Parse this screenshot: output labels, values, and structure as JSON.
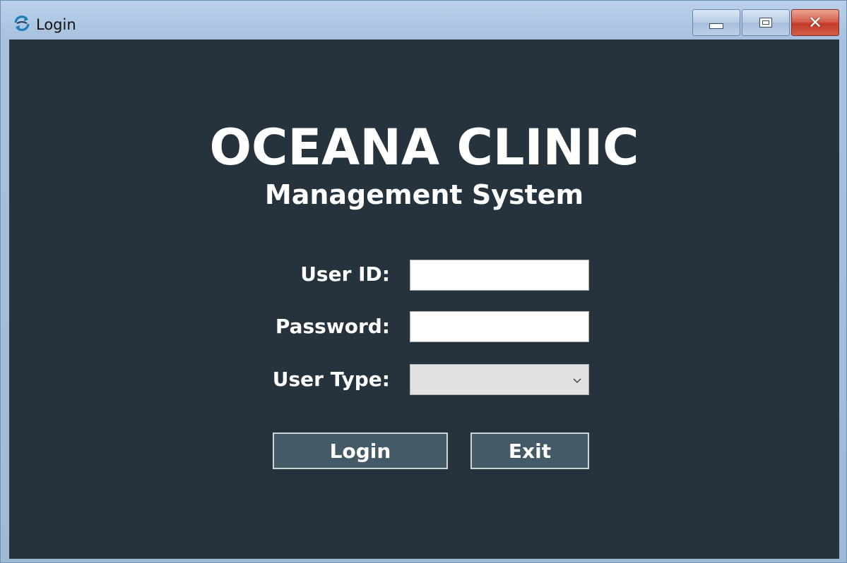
{
  "window": {
    "title": "Login",
    "app_icon": "refresh-icon",
    "controls": {
      "minimize": "minimize-icon",
      "maximize": "maximize-icon",
      "close": "close-icon",
      "close_glyph": "✕"
    }
  },
  "header": {
    "title": "OCEANA CLINIC",
    "subtitle": "Management System"
  },
  "form": {
    "user_id_label": "User ID:",
    "user_id_value": "",
    "password_label": "Password:",
    "password_value": "",
    "user_type_label": "User Type:",
    "user_type_value": ""
  },
  "buttons": {
    "login": "Login",
    "exit": "Exit"
  },
  "colors": {
    "background": "#26323c",
    "button": "#445a67",
    "text": "#ffffff"
  }
}
